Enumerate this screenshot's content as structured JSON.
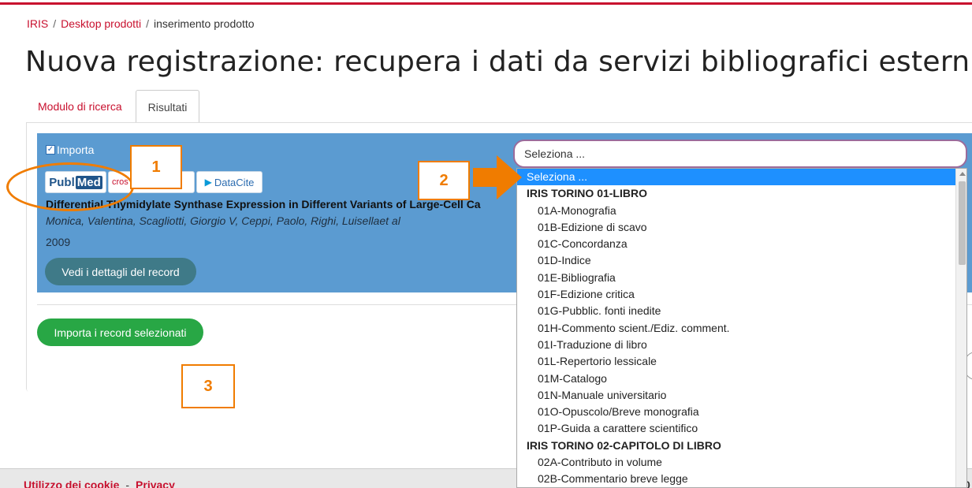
{
  "breadcrumb": {
    "home": "IRIS",
    "desktop": "Desktop prodotti",
    "current": "inserimento prodotto",
    "separator": "/"
  },
  "page_title": "Nuova registrazione: recupera i dati da servizi bibliografici esterni",
  "tabs": {
    "search": "Modulo di ricerca",
    "results": "Risultati"
  },
  "record": {
    "import_label": "Importa",
    "import_checked": true,
    "sources": {
      "pubmed_a": "Publ",
      "pubmed_b": "Med",
      "crossref": "cros",
      "datacite": "DataCite"
    },
    "title": "Differential Thymidylate Synthase Expression in Different Variants of Large-Cell Ca",
    "authors": "Monica, Valentina, Scagliotti, Giorgio V, Ceppi, Paolo, Righi, Luisellaet al",
    "year": "2009",
    "details_button": "Vedi i dettagli del record"
  },
  "import_selected_button": "Importa i record selezionati",
  "select": {
    "value": "Seleziona ...",
    "options": [
      {
        "label": "Seleziona ...",
        "kind": "selected"
      },
      {
        "label": "IRIS TORINO 01-LIBRO",
        "kind": "group"
      },
      {
        "label": "01A-Monografia",
        "kind": "option"
      },
      {
        "label": "01B-Edizione di scavo",
        "kind": "option"
      },
      {
        "label": "01C-Concordanza",
        "kind": "option"
      },
      {
        "label": "01D-Indice",
        "kind": "option"
      },
      {
        "label": "01E-Bibliografia",
        "kind": "option"
      },
      {
        "label": "01F-Edizione critica",
        "kind": "option"
      },
      {
        "label": "01G-Pubblic. fonti inedite",
        "kind": "option"
      },
      {
        "label": "01H-Commento scient./Ediz. comment.",
        "kind": "option"
      },
      {
        "label": "01I-Traduzione di libro",
        "kind": "option"
      },
      {
        "label": "01L-Repertorio lessicale",
        "kind": "option"
      },
      {
        "label": "01M-Catalogo",
        "kind": "option"
      },
      {
        "label": "01N-Manuale universitario",
        "kind": "option"
      },
      {
        "label": "01O-Opuscolo/Breve monografia",
        "kind": "option"
      },
      {
        "label": "01P-Guida a carattere scientifico",
        "kind": "option"
      },
      {
        "label": "IRIS TORINO 02-CAPITOLO DI LIBRO",
        "kind": "group"
      },
      {
        "label": "02A-Contributo in volume",
        "kind": "option"
      },
      {
        "label": "02B-Commentario breve legge",
        "kind": "option"
      }
    ]
  },
  "footer": {
    "cookies": "Utilizzo dei cookie",
    "privacy": "Privacy",
    "dash": "-",
    "right_char": "0"
  },
  "annotations": {
    "one": "1",
    "two": "2",
    "three": "3",
    "color": "#f07c00"
  },
  "colors": {
    "accent": "#c8102e",
    "record_bg": "#5b9bd1",
    "import_button": "#28a745",
    "details_button": "#3f7a88",
    "selected_option": "#1e90ff"
  }
}
